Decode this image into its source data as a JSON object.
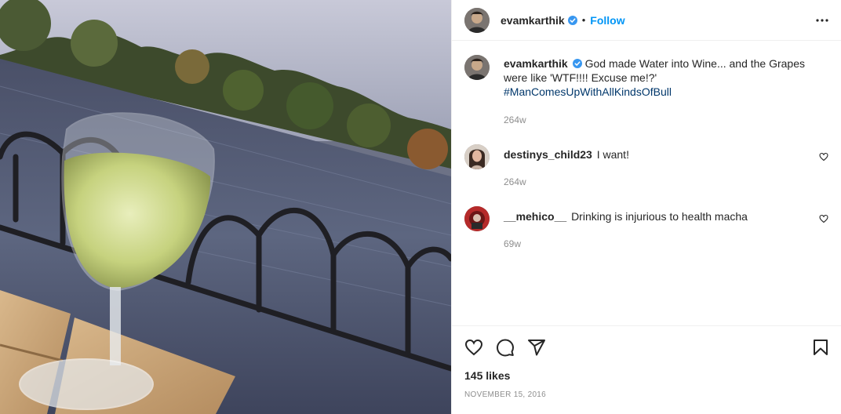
{
  "post": {
    "author": "evamkarthik",
    "follow_label": "Follow",
    "separator": "•"
  },
  "caption": {
    "username": "evamkarthik",
    "text": "God made Water into Wine... and the Grapes were like 'WTF!!!! Excuse me!?'",
    "hashtag": "#ManComesUpWithAllKindsOfBull",
    "time": "264w"
  },
  "comments": [
    {
      "username": "destinys_child23",
      "text": "I want!",
      "time": "264w"
    },
    {
      "username": "__mehico__",
      "text": "Drinking is injurious to health macha",
      "time": "69w"
    }
  ],
  "footer": {
    "likes": "145 likes",
    "date": "NOVEMBER 15, 2016"
  },
  "colors": {
    "follow_blue": "#0095f6",
    "hashtag_blue": "#00376b",
    "verified_blue": "#3897f0",
    "muted_gray": "#8e8e8e"
  },
  "icons": [
    "verified-badge-icon",
    "more-options-icon",
    "heart-icon",
    "comment-icon",
    "share-icon",
    "bookmark-icon"
  ]
}
